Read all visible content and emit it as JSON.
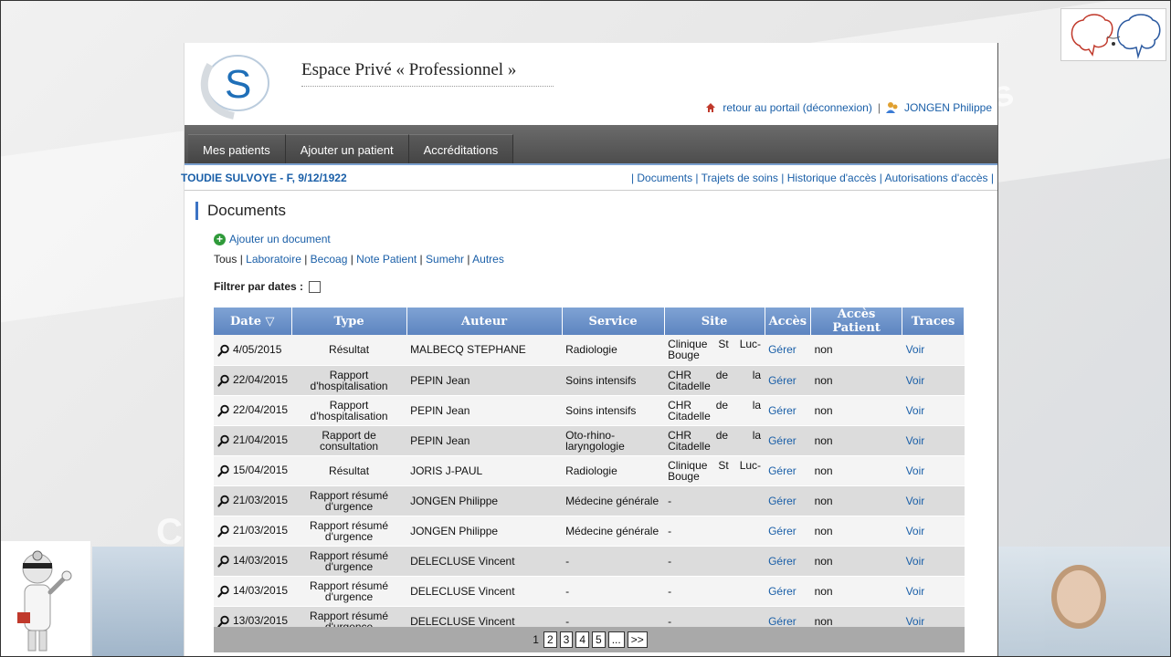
{
  "header": {
    "title": "Espace Privé « Professionnel »",
    "logout_label": "retour au portail (déconnexion)",
    "separator": "|",
    "user_name": "JONGEN Philippe"
  },
  "nav": {
    "tabs": [
      {
        "label": "Mes patients"
      },
      {
        "label": "Ajouter un patient"
      },
      {
        "label": "Accréditations"
      }
    ]
  },
  "patient": {
    "name": "TOUDIE SULVOYE - F, 9/12/1922",
    "links_prefix": "| ",
    "links": [
      "Documents",
      "Trajets de soins",
      "Historique d'accès",
      "Autorisations d'accès"
    ]
  },
  "documents": {
    "section_title": "Documents",
    "add_label": "Ajouter un document",
    "filter_all": "Tous",
    "filter_links": [
      "Laboratoire",
      "Becoag",
      "Note Patient",
      "Sumehr",
      "Autres"
    ],
    "filter_dates_label": "Filtrer par dates :",
    "columns": [
      "Date",
      "Type",
      "Auteur",
      "Service",
      "Site",
      "Accès",
      "Accès Patient",
      "Traces"
    ],
    "sort_indicator": "▽",
    "rows": [
      {
        "date": "4/05/2015",
        "type": "Résultat",
        "auteur": "MALBECQ STEPHANE",
        "service": "Radiologie",
        "site": "Clinique St Luc-Bouge",
        "acces": "Gérer",
        "acces_patient": "non",
        "traces": "Voir"
      },
      {
        "date": "22/04/2015",
        "type": "Rapport d'hospitalisation",
        "auteur": "PEPIN Jean",
        "service": "Soins intensifs",
        "site": "CHR de la Citadelle",
        "acces": "Gérer",
        "acces_patient": "non",
        "traces": "Voir"
      },
      {
        "date": "22/04/2015",
        "type": "Rapport d'hospitalisation",
        "auteur": "PEPIN Jean",
        "service": "Soins intensifs",
        "site": "CHR de la Citadelle",
        "acces": "Gérer",
        "acces_patient": "non",
        "traces": "Voir"
      },
      {
        "date": "21/04/2015",
        "type": "Rapport de consultation",
        "auteur": "PEPIN Jean",
        "service": "Oto-rhino-laryngologie",
        "site": "CHR de la Citadelle",
        "acces": "Gérer",
        "acces_patient": "non",
        "traces": "Voir"
      },
      {
        "date": "15/04/2015",
        "type": "Résultat",
        "auteur": "JORIS J-PAUL",
        "service": "Radiologie",
        "site": "Clinique St Luc-Bouge",
        "acces": "Gérer",
        "acces_patient": "non",
        "traces": "Voir"
      },
      {
        "date": "21/03/2015",
        "type": "Rapport résumé d'urgence",
        "auteur": "JONGEN Philippe",
        "service": "Médecine générale",
        "site": "-",
        "acces": "Gérer",
        "acces_patient": "non",
        "traces": "Voir"
      },
      {
        "date": "21/03/2015",
        "type": "Rapport résumé d'urgence",
        "auteur": "JONGEN Philippe",
        "service": "Médecine générale",
        "site": "-",
        "acces": "Gérer",
        "acces_patient": "non",
        "traces": "Voir"
      },
      {
        "date": "14/03/2015",
        "type": "Rapport résumé d'urgence",
        "auteur": "DELECLUSE Vincent",
        "service": "-",
        "site": "-",
        "acces": "Gérer",
        "acces_patient": "non",
        "traces": "Voir"
      },
      {
        "date": "14/03/2015",
        "type": "Rapport résumé d'urgence",
        "auteur": "DELECLUSE Vincent",
        "service": "-",
        "site": "-",
        "acces": "Gérer",
        "acces_patient": "non",
        "traces": "Voir"
      },
      {
        "date": "13/03/2015",
        "type": "Rapport résumé d'urgence",
        "auteur": "DELECLUSE Vincent",
        "service": "-",
        "site": "-",
        "acces": "Gérer",
        "acces_patient": "non",
        "traces": "Voir"
      }
    ]
  },
  "pager": {
    "current": "1",
    "pages": [
      "2",
      "3",
      "4",
      "5"
    ],
    "ellipsis": "...",
    "next": ">>"
  },
  "watermarks": {
    "top_fragment": "ervés",
    "left_fragment": "C"
  },
  "colors": {
    "accent": "#5d85c0",
    "link": "#1a5fa8",
    "navbar": "#4d4d4d"
  },
  "icons": [
    "s-logo-icon",
    "portal-house-icon",
    "user-icon",
    "plus-circle-icon",
    "magnifier-icon",
    "sort-down-icon",
    "brain-logo-icon",
    "doctor-illustration-icon"
  ]
}
